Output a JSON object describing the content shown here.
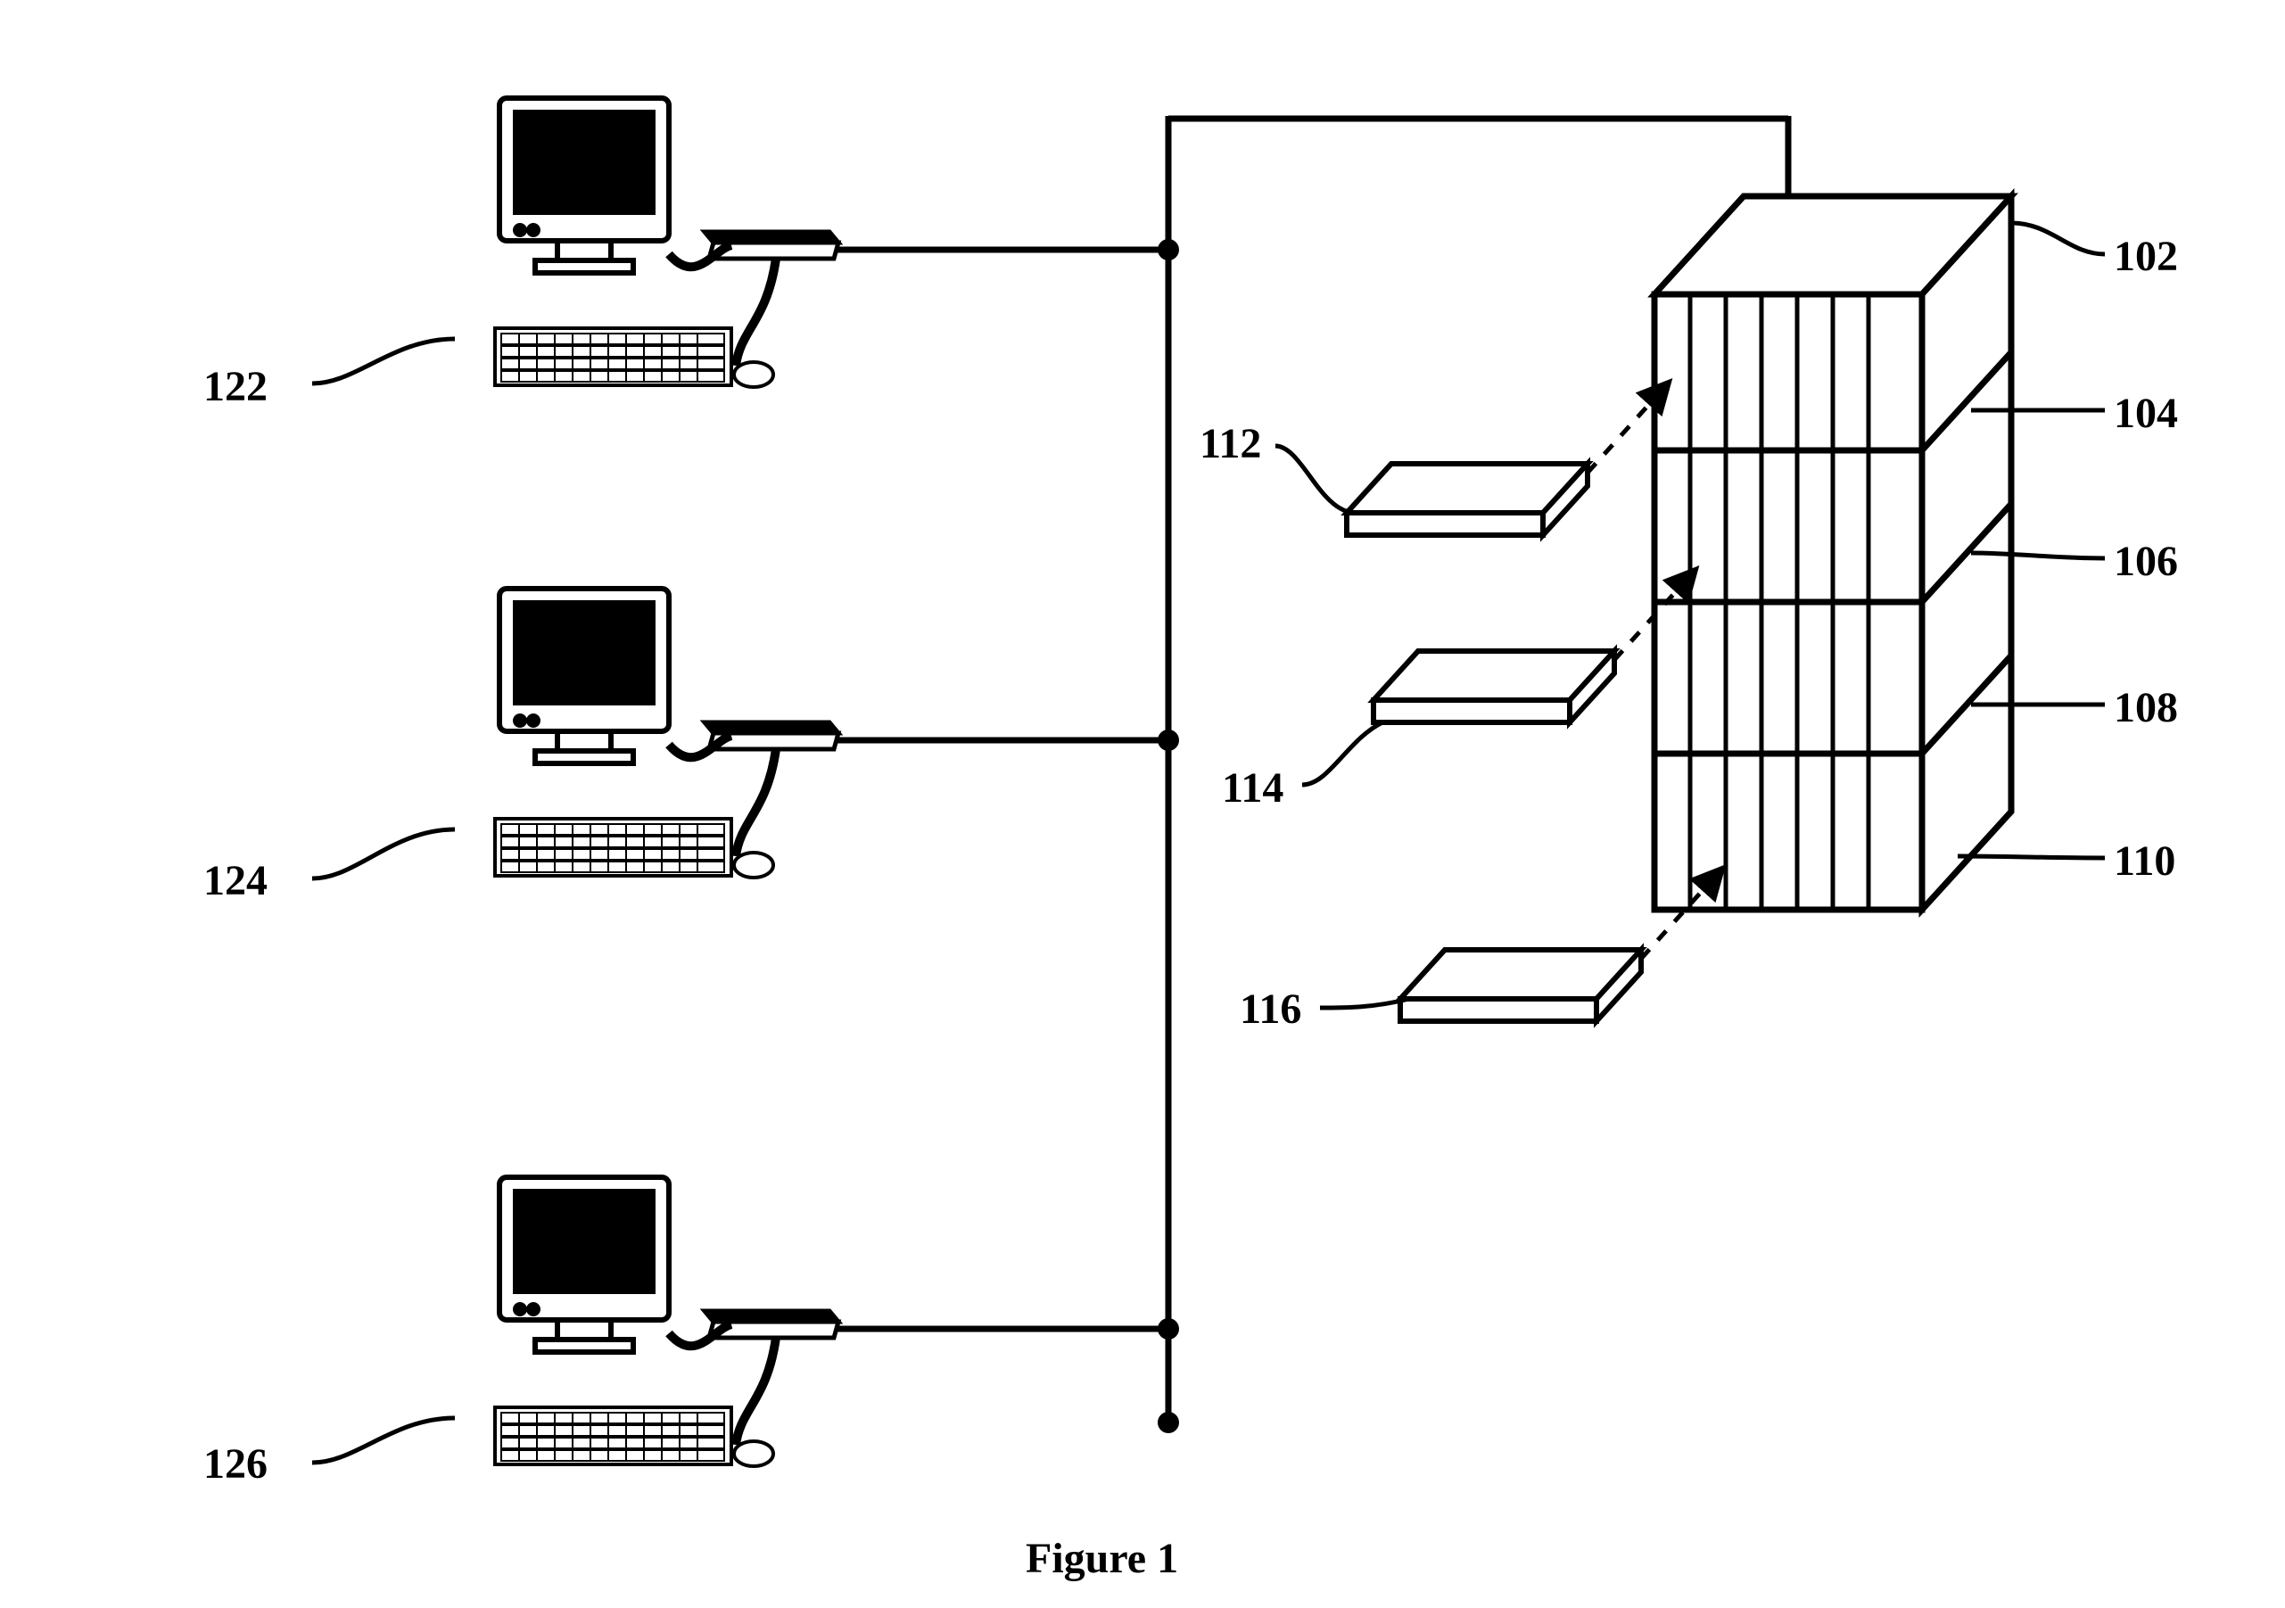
{
  "figure_caption": "Figure 1",
  "labels": {
    "l102": "102",
    "l104": "104",
    "l106": "106",
    "l108": "108",
    "l110": "110",
    "l112": "112",
    "l114": "114",
    "l116": "116",
    "l122": "122",
    "l124": "124",
    "l126": "126"
  }
}
